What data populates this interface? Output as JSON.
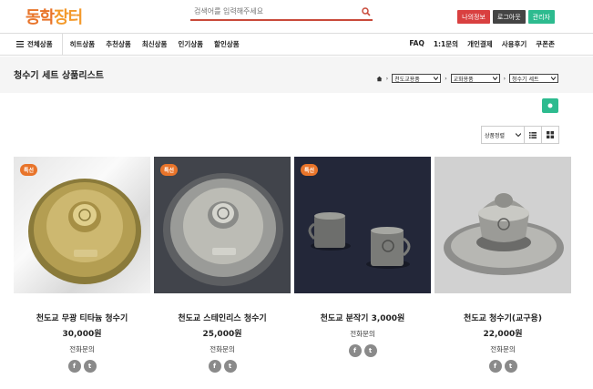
{
  "logo": {
    "part1": "동학",
    "part2": "장터"
  },
  "search": {
    "placeholder": "검색어를 입력해주세요",
    "icon": "search-icon"
  },
  "top_buttons": [
    {
      "label": "나의정보",
      "color": "#d94040"
    },
    {
      "label": "로그아웃",
      "color": "#444444"
    },
    {
      "label": "관리자",
      "color": "#2dbb8f"
    }
  ],
  "nav": {
    "all_label": "전체상품",
    "menu": [
      "히트상품",
      "추천상품",
      "최신상품",
      "인기상품",
      "할인상품"
    ],
    "right": [
      "FAQ",
      "1:1문의",
      "개인결제",
      "사용후기",
      "쿠폰존"
    ]
  },
  "page": {
    "title": "청수기 세트 상품리스트",
    "breadcrumbs": [
      "천도교용품",
      "교화용품",
      "청수기 세트"
    ]
  },
  "sort": {
    "label": "상품정렬"
  },
  "products": [
    {
      "name": "천도교 무광 티타늄 청수기",
      "price": "30,000원",
      "phone": "전화문의",
      "badge": "특선"
    },
    {
      "name": "천도교 스테인리스 청수기",
      "price": "25,000원",
      "phone": "전화문의",
      "badge": "특선"
    },
    {
      "name": "천도교 분작기 3,000원",
      "price": "",
      "phone": "전화문의",
      "badge": "특선"
    },
    {
      "name": "천도교 청수기(교구용)",
      "price": "22,000원",
      "phone": "전화문의",
      "badge": ""
    }
  ],
  "share_icons": [
    "facebook-icon",
    "twitter-icon"
  ],
  "colors": {
    "accent": "#e8742a",
    "search_border": "#c94a3a",
    "green": "#2dbb8f"
  }
}
